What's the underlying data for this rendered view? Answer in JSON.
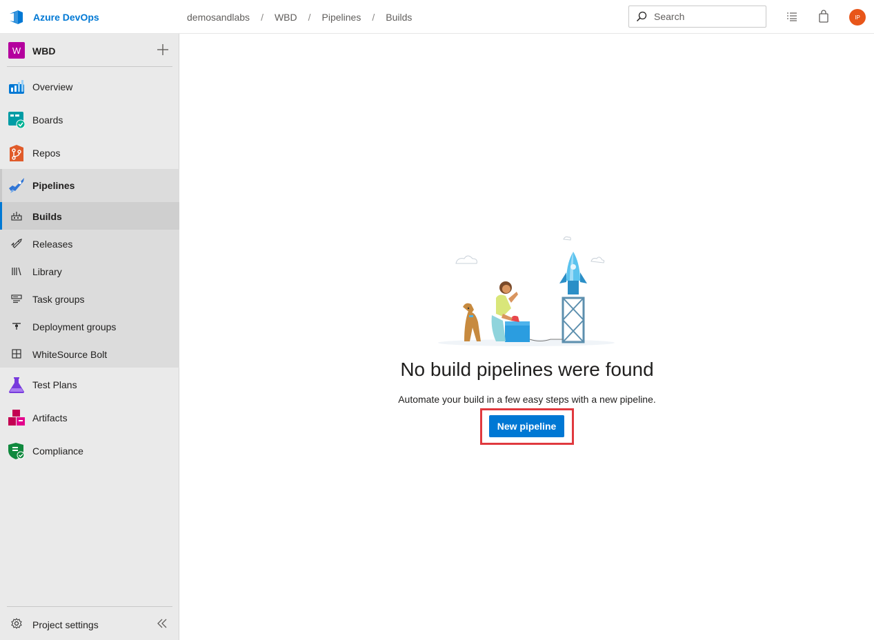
{
  "app": {
    "brand": "Azure DevOps"
  },
  "breadcrumb": [
    "demosandlabs",
    "WBD",
    "Pipelines",
    "Builds"
  ],
  "search": {
    "placeholder": "Search"
  },
  "user": {
    "initials": "IP",
    "avatar_color": "#e8561a"
  },
  "project": {
    "initial": "W",
    "name": "WBD",
    "color": "#b4009e"
  },
  "nav": {
    "overview": "Overview",
    "boards": "Boards",
    "repos": "Repos",
    "pipelines": "Pipelines",
    "builds": "Builds",
    "releases": "Releases",
    "library": "Library",
    "task_groups": "Task groups",
    "deployment_groups": "Deployment groups",
    "whitesource": "WhiteSource Bolt",
    "test_plans": "Test Plans",
    "artifacts": "Artifacts",
    "compliance": "Compliance"
  },
  "footer": {
    "settings": "Project settings"
  },
  "empty_state": {
    "title": "No build pipelines were found",
    "subtitle": "Automate your build in a few easy steps with a new pipeline.",
    "button": "New pipeline"
  },
  "colors": {
    "accent": "#0078d4",
    "highlight": "#e0393e"
  }
}
